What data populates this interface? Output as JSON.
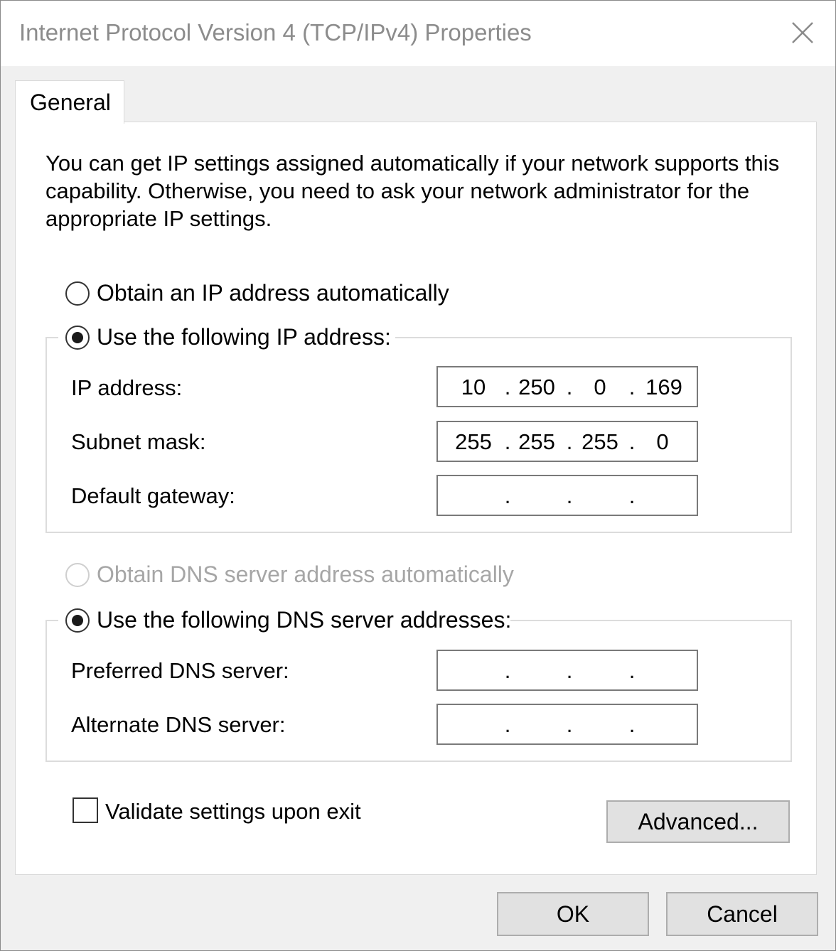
{
  "window": {
    "title": "Internet Protocol Version 4 (TCP/IPv4) Properties"
  },
  "tabs": [
    {
      "label": "General",
      "active": true
    }
  ],
  "description": "You can get IP settings assigned automatically if your network supports this capability. Otherwise, you need to ask your network administrator for the appropriate IP settings.",
  "ip_mode": {
    "auto_label": "Obtain an IP address automatically",
    "manual_label": "Use the following IP address:",
    "selected": "manual"
  },
  "ip_fields": {
    "ip_address": {
      "label": "IP address:",
      "octets": [
        "10",
        "250",
        "0",
        "169"
      ]
    },
    "subnet_mask": {
      "label": "Subnet mask:",
      "octets": [
        "255",
        "255",
        "255",
        "0"
      ]
    },
    "default_gateway": {
      "label": "Default gateway:",
      "octets": [
        "",
        "",
        "",
        ""
      ]
    }
  },
  "dns_mode": {
    "auto_label": "Obtain DNS server address automatically",
    "manual_label": "Use the following DNS server addresses:",
    "selected": "manual",
    "auto_disabled": true
  },
  "dns_fields": {
    "preferred": {
      "label": "Preferred DNS server:",
      "octets": [
        "",
        "",
        "",
        ""
      ]
    },
    "alternate": {
      "label": "Alternate DNS server:",
      "octets": [
        "",
        "",
        "",
        ""
      ]
    }
  },
  "validate": {
    "label": "Validate settings upon exit",
    "checked": false
  },
  "buttons": {
    "advanced": "Advanced...",
    "ok": "OK",
    "cancel": "Cancel"
  },
  "ip_separator": "."
}
